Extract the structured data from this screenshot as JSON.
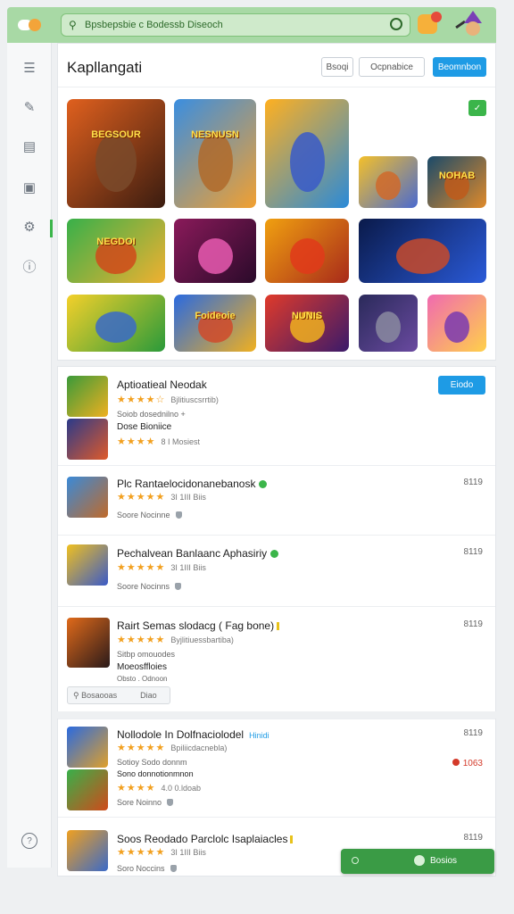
{
  "header": {
    "search_placeholder": "Bpsbepsbie c Bodessb Diseoch",
    "notification_count": "1"
  },
  "sidebar": {
    "items": [
      {
        "icon": "list-icon"
      },
      {
        "icon": "chat-icon"
      },
      {
        "icon": "calendar-icon"
      },
      {
        "icon": "image-icon"
      },
      {
        "icon": "puzzle-icon"
      },
      {
        "icon": "info-icon"
      }
    ],
    "help_icon": "help-icon"
  },
  "featured": {
    "title": "Kapllangati",
    "buttons": [
      "Bsoqi",
      "Ocpnabice",
      "Beomnbon"
    ],
    "tiles": [
      {
        "label": "BEGSOUR",
        "bg1": "#e0601e",
        "bg2": "#3a1c10",
        "fig": "#7a4a2a"
      },
      {
        "label": "NESNUSN",
        "bg1": "#3a8ee0",
        "bg2": "#f2a030",
        "fig": "#b06a2a"
      },
      {
        "label": "",
        "bg1": "#ffb020",
        "bg2": "#2a8ad8",
        "fig": "#3a5ac8"
      },
      {
        "label": "",
        "bg1": "#f4c02a",
        "bg2": "#4a6ad0",
        "fig": "#d06a2a"
      },
      {
        "label": "NOHAB",
        "bg1": "#1a4a6a",
        "bg2": "#e08a2a",
        "fig": "#c05a1a"
      },
      {
        "label": "NEGDOI",
        "bg1": "#38b04a",
        "bg2": "#f0b030",
        "fig": "#d04a1a"
      },
      {
        "label": "",
        "bg1": "#8a1a5a",
        "bg2": "#2a0a2a",
        "fig": "#e85ab0"
      },
      {
        "label": "",
        "bg1": "#f0a010",
        "bg2": "#a82a1a",
        "fig": "#e03a1a"
      },
      {
        "label": "",
        "bg1": "#0a1a4a",
        "bg2": "#2a5ad8",
        "fig": "#c84a2a"
      },
      {
        "label": "",
        "bg1": "#f4d02a",
        "bg2": "#2a9a3a",
        "fig": "#3a6ac8"
      },
      {
        "label": "Foideoie",
        "bg1": "#2a6ae0",
        "bg2": "#f0b020",
        "fig": "#d04a2a"
      },
      {
        "label": "NUNIS",
        "bg1": "#e03a2a",
        "bg2": "#3a1a6a",
        "fig": "#f0b020"
      },
      {
        "label": "",
        "bg1": "#2a2a5a",
        "bg2": "#6a4aa0",
        "fig": "#8a8aa0"
      },
      {
        "label": "",
        "bg1": "#f06ab0",
        "bg2": "#ffd04a",
        "fig": "#7a3ab0"
      }
    ],
    "status_chip": "✓"
  },
  "list": {
    "rows": [
      {
        "title": "Aptioatieal Neodak",
        "stars": "★★★★☆",
        "rating_note": "Bjlitiuscsrrtib)",
        "meta1": "Soiob dosednilno +",
        "meta2": "Dose Bioniice",
        "stars2": "★★★★",
        "rating_note2": "8 I Mosiest",
        "button": "Eiodo"
      },
      {
        "title": "Plc Rantaelocidonanebanosk",
        "stars": "★★★★★",
        "rating_note": "3I 1III Biis",
        "meta": "Soore Nocinne",
        "price": "8119"
      },
      {
        "title": "Pechalvean Banlaanc Aphasiriy",
        "stars": "★★★★★",
        "rating_note": "3I 1III Biis",
        "meta": "Soore Nocinns",
        "price": "8119"
      },
      {
        "title": "Rairt Semas slodacg ( Fag bone)",
        "stars": "★★★★★",
        "rating_note": "Byjlitiuessbartiba)",
        "meta1": "Sitbp omouodes",
        "meta2": "Moeosffloies",
        "meta3": "Obsto . Odnoon",
        "search_label": "Bosaooas",
        "search_hint": "Diao",
        "price": "8119"
      },
      {
        "title": "Nollodole In Dolfnaciolodel",
        "title_tag": "Hinidi",
        "stars": "★★★★★",
        "rating_note": "Bpiliicdacnebla)",
        "meta1": "Sotioy Sodo donnm",
        "meta_dark": "Sono donnotionmnon",
        "stars2": "★★★★",
        "rating_note2": "4.0 0.ldoab",
        "meta2": "Sore Noinno",
        "price": "8119",
        "sale": "1063"
      },
      {
        "title": "Soos Reodado Parclolc Isaplaiacles",
        "stars": "★★★★★",
        "rating_note": "3I 1III Biis",
        "meta": "Soro Noccins",
        "price": "8119"
      }
    ]
  },
  "action_bar": {
    "label": "Bosios"
  }
}
